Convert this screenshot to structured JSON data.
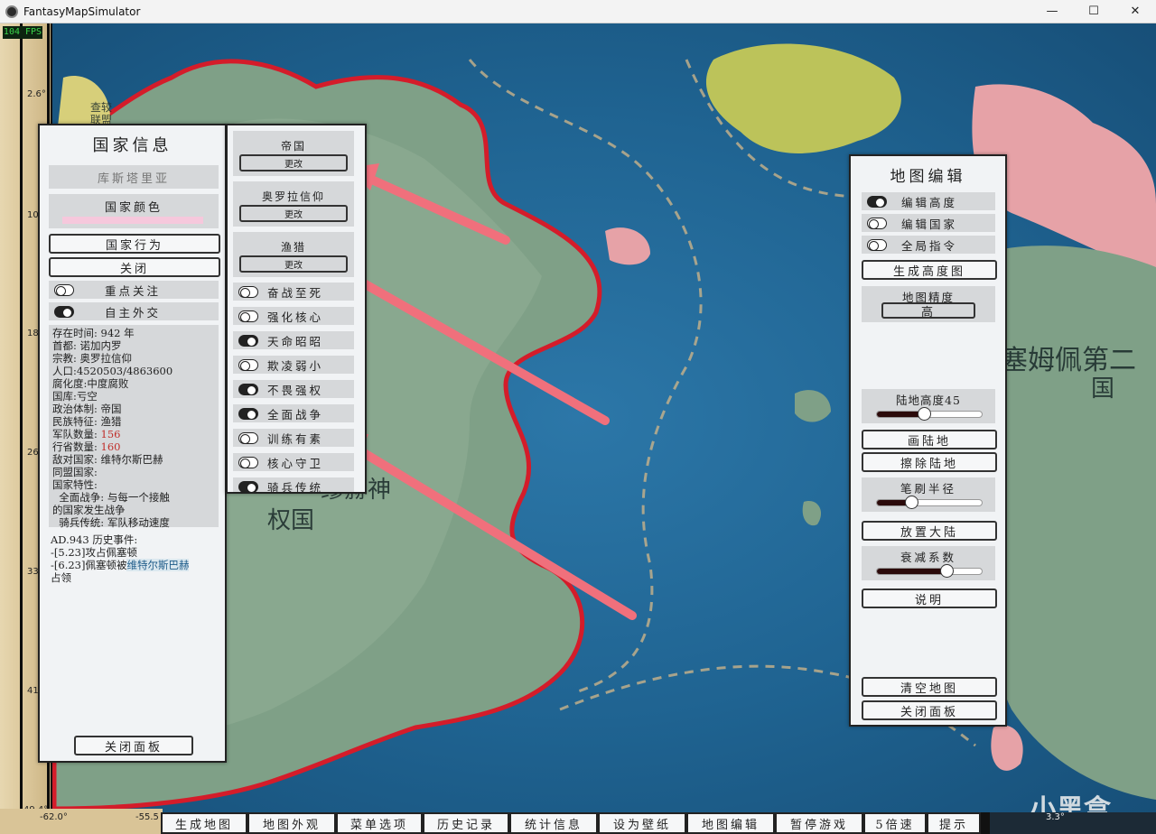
{
  "window": {
    "title": "FantasyMapSimulator",
    "controls": [
      "—",
      "☐",
      "✕"
    ]
  },
  "fps": "104 FPS",
  "map": {
    "latitudes": [
      "2.6°",
      "10.",
      "18.",
      "26.",
      "33.",
      "41.",
      "49.4°"
    ],
    "longitudes": [
      "-62.0°",
      "-55.5",
      "3.3°"
    ],
    "labels": {
      "chajiao": "查较\n联盟",
      "empire_fragment": "缪赫神",
      "empire_fragment2": "权国",
      "east_country": "塞姆佩第二",
      "east_country2": "国"
    },
    "watermark": "小黑盒"
  },
  "country_panel": {
    "title": "国家信息",
    "name": "库斯塔里亚",
    "color_label": "国家颜色",
    "color_value": "#f6c8dc",
    "action_button": "国家行为",
    "close_small": "关闭",
    "focus_label": "重点关注",
    "diplomacy_label": "自主外交",
    "info_lines": [
      "存在时间: 942 年",
      "首都: 诺加内罗",
      "宗教: 奥罗拉信仰",
      "人口:4520503/4863600",
      "腐化度:中度腐败",
      "国库:亏空",
      "政治体制: 帝国",
      "民族特征: 渔猎"
    ],
    "army_label": "军队数量:",
    "army_value": "156",
    "provinces_label": "行省数量:",
    "provinces_value": "160",
    "enemy_line": "敌对国家: 维特尔斯巴赫",
    "ally_line": "同盟国家:",
    "traits_header": "国家特性:",
    "trait_desc_1": "  全面战争: 与每一个接触",
    "trait_desc_2": "的国家发生战争",
    "trait_desc_3": "  骑兵传统: 军队移动速度",
    "history_header": "AD.943 历史事件:",
    "history_1": "-[5.23]攻占佩塞顿",
    "history_2a": "-[6.23]佩塞顿被",
    "history_2b": "维特尔斯巴赫",
    "history_2c": "占领",
    "close_panel": "关闭面板"
  },
  "trait_panel": {
    "boxes": [
      {
        "name": "帝国",
        "button": "更改"
      },
      {
        "name": "奥罗拉信仰",
        "button": "更改"
      },
      {
        "name": "渔猎",
        "button": "更改"
      }
    ],
    "toggles": [
      {
        "label": "奋战至死",
        "on": false
      },
      {
        "label": "强化核心",
        "on": false
      },
      {
        "label": "天命昭昭",
        "on": true
      },
      {
        "label": "欺凌弱小",
        "on": false
      },
      {
        "label": "不畏强权",
        "on": true
      },
      {
        "label": "全面战争",
        "on": true
      },
      {
        "label": "训练有素",
        "on": false
      },
      {
        "label": "核心守卫",
        "on": false
      },
      {
        "label": "骑兵传统",
        "on": true
      }
    ]
  },
  "map_edit_panel": {
    "title": "地图编辑",
    "toggles": [
      {
        "label": "编辑高度",
        "on": true
      },
      {
        "label": "编辑国家",
        "on": false
      },
      {
        "label": "全局指令",
        "on": false
      }
    ],
    "gen_height": "生成高度图",
    "precision_label": "地图精度",
    "precision_value": "高",
    "land_height_label": "陆地高度45",
    "land_height_fraction": 0.45,
    "draw_land": "画陆地",
    "erase_land": "擦除陆地",
    "brush_label": "笔刷半径",
    "brush_fraction": 0.33,
    "place_continent": "放置大陆",
    "decay_label": "衰减系数",
    "decay_fraction": 0.66,
    "help": "说明",
    "clear_map": "清空地图",
    "close_panel": "关闭面板"
  },
  "bottom_bar": [
    "生成地图",
    "地图外观",
    "菜单选项",
    "历史记录",
    "统计信息",
    "设为壁纸",
    "地图编辑",
    "暂停游戏",
    "5倍速",
    "提示"
  ]
}
